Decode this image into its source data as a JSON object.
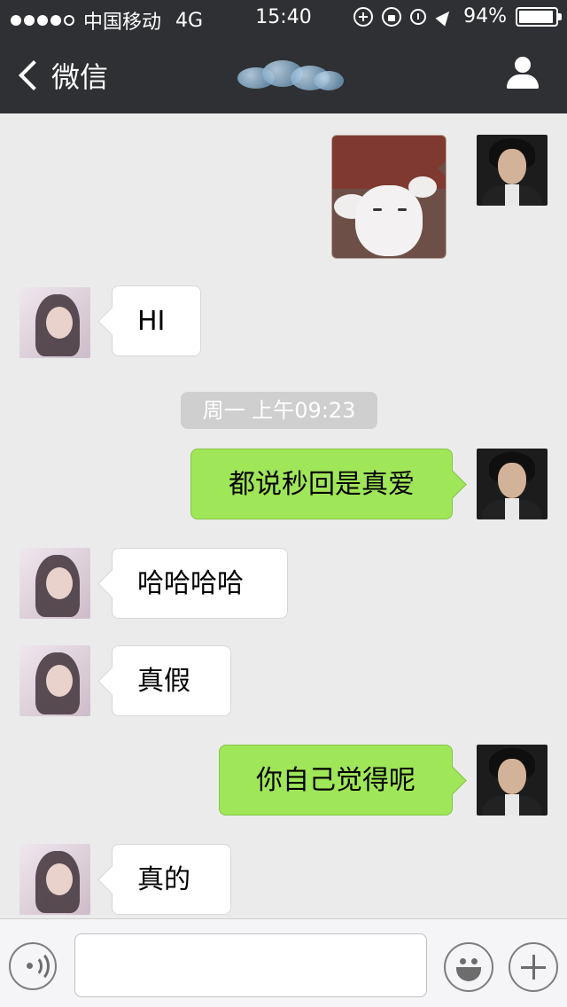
{
  "status": {
    "carrier": "中国移动",
    "network": "4G",
    "time": "15:40",
    "battery": "94%",
    "battery_level": 0.94
  },
  "nav": {
    "back_label": "微信",
    "title_icon": "cloud-avatar-icon",
    "profile_icon": "profile-icon"
  },
  "messages": [
    {
      "side": "out",
      "type": "image",
      "content": "rabbit-sticker"
    },
    {
      "side": "in",
      "text": "HI"
    },
    {
      "type": "timestamp",
      "text": "周一 上午09:23"
    },
    {
      "side": "out",
      "text": "都说秒回是真爱"
    },
    {
      "side": "in",
      "text": "哈哈哈哈"
    },
    {
      "side": "in",
      "text": "真假"
    },
    {
      "side": "out",
      "text": "你自己觉得呢"
    },
    {
      "side": "in",
      "text": "真的"
    }
  ],
  "input": {
    "value": "",
    "placeholder": ""
  },
  "colors": {
    "nav_bg": "#2e3033",
    "chat_bg": "#ebebeb",
    "out_bubble": "#9fe658",
    "in_bubble": "#ffffff",
    "timestamp_bg": "#cfcfcf"
  }
}
